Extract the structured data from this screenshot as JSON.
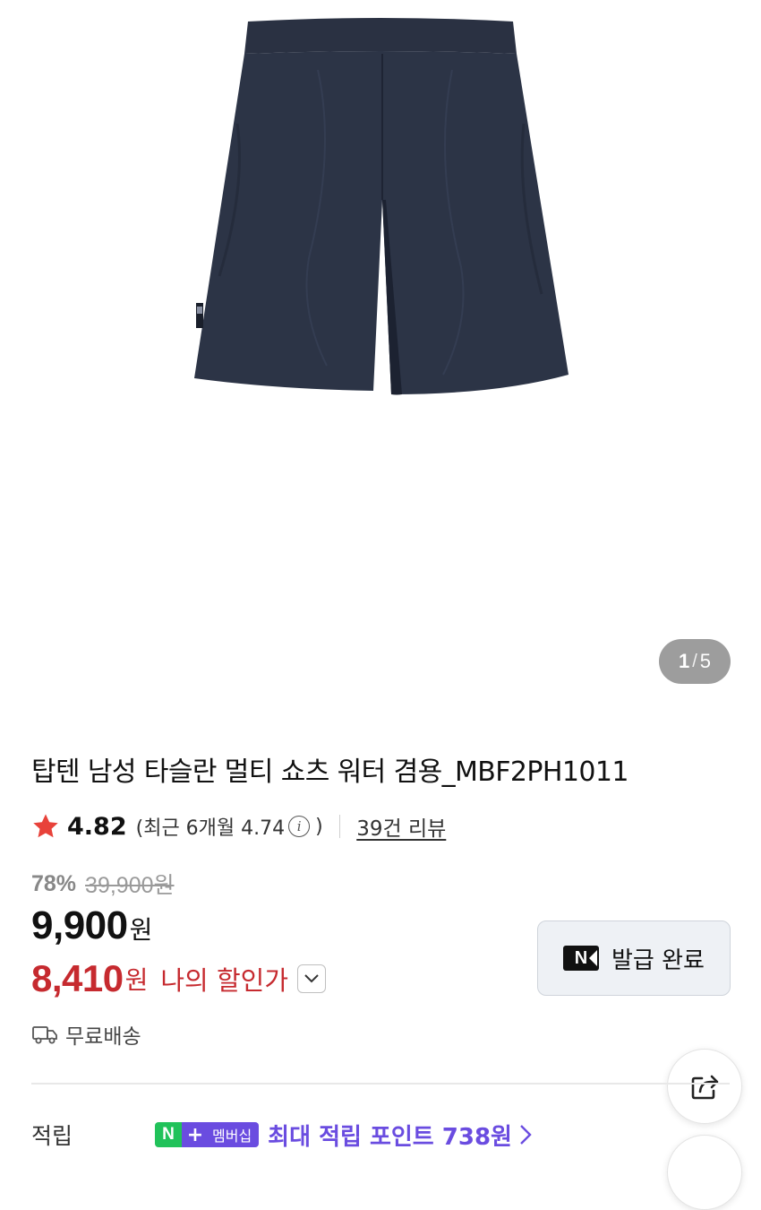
{
  "gallery": {
    "current": "1",
    "separator": "/",
    "total": "5",
    "image_icon": "navy-shorts-product-photo"
  },
  "product": {
    "title": "탑텐 남성 타슬란 멀티 쇼츠 워터 겸용_MBF2PH1011"
  },
  "rating": {
    "star_icon": "star-icon",
    "star_color": "#e8423a",
    "value": "4.82",
    "recent_prefix": "(최근 6개월 4.74",
    "info_glyph": "i",
    "recent_suffix": ")",
    "review_link": "39건 리뷰"
  },
  "pricing": {
    "discount_rate": "78%",
    "original_price": "39,900원",
    "price": "9,900",
    "price_unit": "원",
    "my_price": "8,410",
    "my_price_unit": "원",
    "my_price_label": "나의 할인가",
    "sale_color": "#c62a2f"
  },
  "coupon": {
    "badge": "N",
    "label": "발급 완료",
    "icon": "naver-n-badge-icon"
  },
  "shipping": {
    "icon": "truck-icon",
    "label": "무료배송"
  },
  "points": {
    "label": "적립",
    "badge_n": "N",
    "badge_plus": "+",
    "badge_member": "멤버십",
    "text": "최대 적립 포인트 738원",
    "accent": "#6a4ce0",
    "green": "#21c25a"
  },
  "actions": {
    "share_icon": "share-icon"
  }
}
